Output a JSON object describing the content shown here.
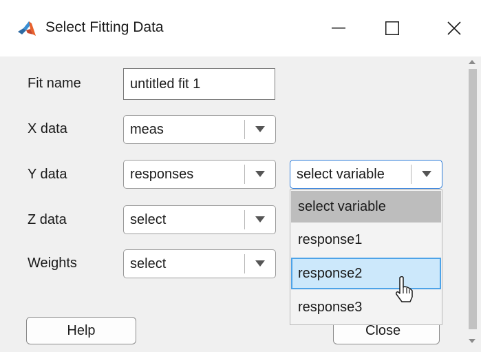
{
  "window": {
    "title": "Select Fitting Data",
    "app_icon": "matlab-logo",
    "controls": [
      "minimize-icon",
      "maximize-icon",
      "close-icon"
    ]
  },
  "form": {
    "fit_name_label": "Fit name",
    "fit_name_value": "untitled fit 1",
    "x_label": "X data",
    "x_value": "meas",
    "y_label": "Y data",
    "y_value": "responses",
    "y_variable_value": "select variable",
    "z_label": "Z data",
    "z_value": "select",
    "weights_label": "Weights",
    "weights_value": "select"
  },
  "dropdown": {
    "options": [
      "select variable",
      "response1",
      "response2",
      "response3"
    ],
    "selected": "select variable",
    "hovered": "response2"
  },
  "buttons": {
    "help": "Help",
    "close": "Close"
  },
  "colors": {
    "hover_fill": "#cce8fb",
    "hover_border": "#4da3e8",
    "selected_fill": "#bdbdbd",
    "focus_border": "#2a7ad8"
  }
}
